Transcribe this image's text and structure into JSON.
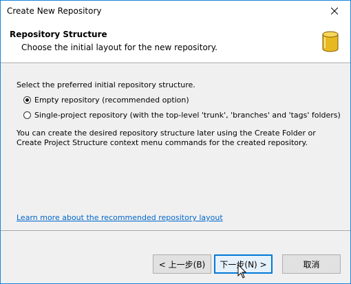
{
  "window": {
    "title": "Create New Repository"
  },
  "header": {
    "title": "Repository Structure",
    "subtitle": "Choose the initial layout for the new repository."
  },
  "content": {
    "prompt": "Select the preferred initial repository structure.",
    "options": [
      {
        "label": "Empty repository (recommended option)",
        "selected": true
      },
      {
        "label": "Single-project repository (with the top-level 'trunk', 'branches' and 'tags' folders)",
        "selected": false
      }
    ],
    "description": "You can create the desired repository structure later using the Create Folder or Create Project Structure context menu commands for the created repository.",
    "learn_more_link": "Learn more about the recommended repository layout"
  },
  "footer": {
    "back_label": "< 上一步(B)",
    "next_label": "下一步(N) >",
    "cancel_label": "取消"
  },
  "colors": {
    "window_border": "#1883d7",
    "link": "#0066cc",
    "focus_border": "#0078d7",
    "db_icon": "#e8b820"
  }
}
